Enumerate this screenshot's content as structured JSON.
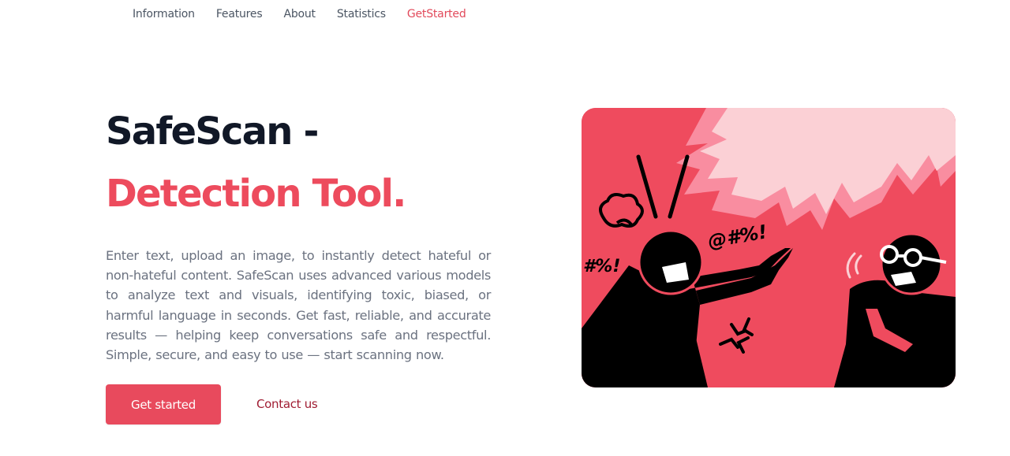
{
  "nav": {
    "items": [
      {
        "label": "Information"
      },
      {
        "label": "Features"
      },
      {
        "label": "About"
      },
      {
        "label": "Statistics"
      },
      {
        "label": "GetStarted",
        "active": true
      }
    ]
  },
  "hero": {
    "title_line1": "SafeScan -",
    "title_line2": "Detection Tool.",
    "description": "Enter text, upload an image, to instantly detect hateful or non-hateful content. SafeScan uses advanced various models to analyze text and visuals, identifying toxic, biased, or harmful language in seconds. Get fast, reliable, and accurate results — helping keep conversations safe and respectful. Simple, secure, and easy to use — start scanning now.",
    "primary_button": "Get started",
    "secondary_link": "Contact us"
  },
  "illustration": {
    "symbols_top": "@#%!",
    "symbols_left": "#%!",
    "symbols_bottom_left": "#%!"
  },
  "colors": {
    "accent": "#ed4b5d",
    "heading": "#111827",
    "body_text": "#6b7280",
    "link": "#a01d33",
    "illustration_bg": "#ef4b5e",
    "speech_burst": "#fbd0d5"
  }
}
